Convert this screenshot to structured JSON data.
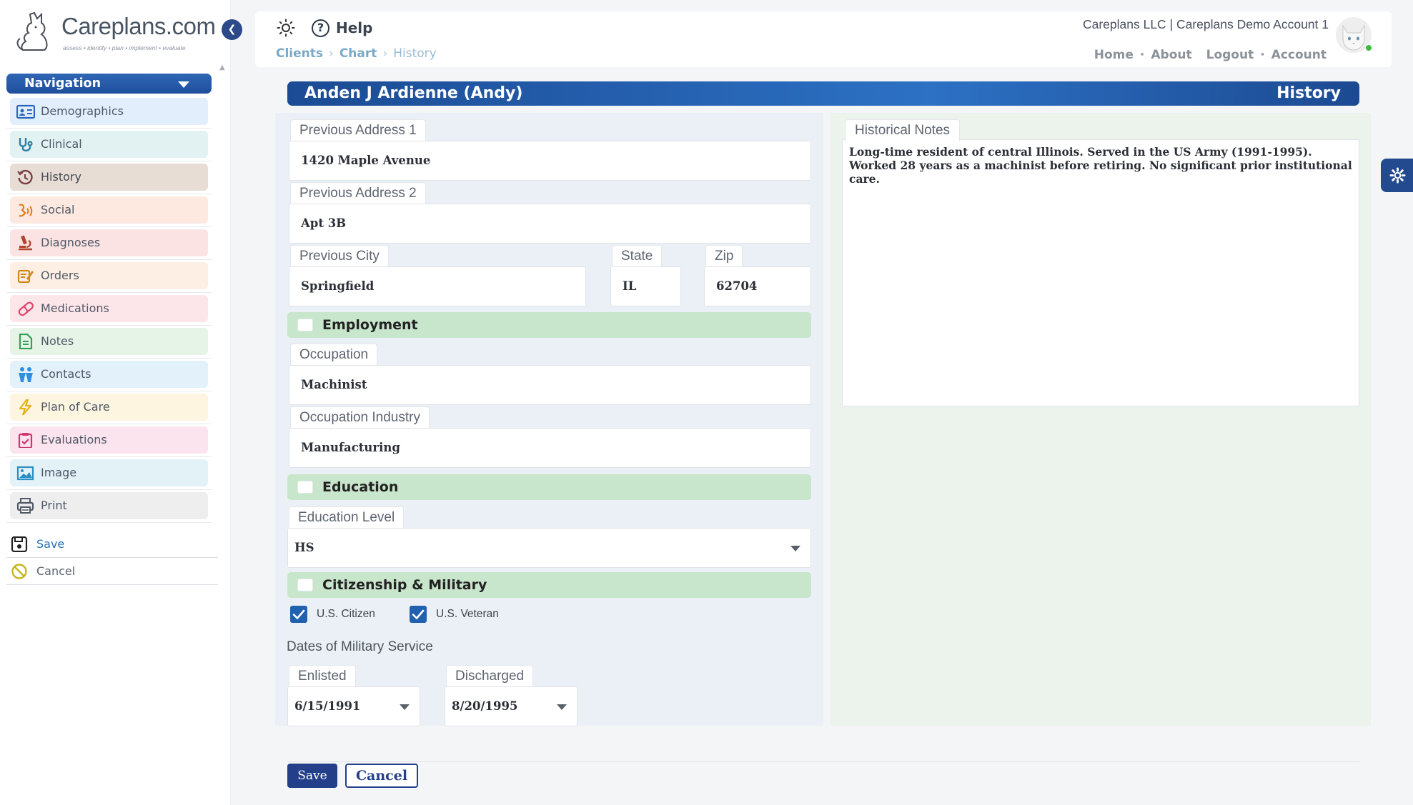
{
  "brand": {
    "name": "Careplans.com",
    "tagline": "assess • identify • plan • implement • evaluate"
  },
  "nav": {
    "header": "Navigation",
    "items": [
      {
        "label": "Demographics",
        "icon": "id-card-icon",
        "bg": "#e3eefc",
        "color": "#2a66c0"
      },
      {
        "label": "Clinical",
        "icon": "stethoscope-icon",
        "bg": "#e2f1f1",
        "color": "#2a7fa6"
      },
      {
        "label": "History",
        "icon": "history-icon",
        "bg": "#e7ddd4",
        "color": "#7a3f4a"
      },
      {
        "label": "Social",
        "icon": "social-icon",
        "bg": "#fde9df",
        "color": "#e07a1f"
      },
      {
        "label": "Diagnoses",
        "icon": "microscope-icon",
        "bg": "#fbe3e3",
        "color": "#b0462d"
      },
      {
        "label": "Orders",
        "icon": "orders-icon",
        "bg": "#fdefe3",
        "color": "#d28a17"
      },
      {
        "label": "Medications",
        "icon": "pill-icon",
        "bg": "#fde6ea",
        "color": "#e0456b"
      },
      {
        "label": "Notes",
        "icon": "note-icon",
        "bg": "#e6f4e8",
        "color": "#34a053"
      },
      {
        "label": "Contacts",
        "icon": "people-icon",
        "bg": "#e3f1fb",
        "color": "#2d8fe0"
      },
      {
        "label": "Plan of Care",
        "icon": "bolt-icon",
        "bg": "#fdf5df",
        "color": "#e6b318"
      },
      {
        "label": "Evaluations",
        "icon": "clipboard-icon",
        "bg": "#fbe4ee",
        "color": "#d1356f"
      },
      {
        "label": "Image",
        "icon": "image-icon",
        "bg": "#e2f2f7",
        "color": "#2b8fc4"
      },
      {
        "label": "Print",
        "icon": "printer-icon",
        "bg": "#eeeeef",
        "color": "#4f5a66"
      }
    ],
    "save_label": "Save",
    "cancel_label": "Cancel"
  },
  "topbar": {
    "help_label": "Help",
    "breadcrumb": [
      "Clients",
      "Chart",
      "History"
    ],
    "account_name": "Careplans LLC | Careplans Demo Account 1",
    "links": [
      "Home",
      "About",
      "Logout",
      "Account"
    ]
  },
  "page": {
    "client_name": "Anden J Ardienne (Andy)",
    "section_title": "History"
  },
  "form": {
    "prev_address1": {
      "label": "Previous Address 1",
      "value": "1420 Maple Avenue"
    },
    "prev_address2": {
      "label": "Previous Address 2",
      "value": "Apt 3B"
    },
    "prev_city": {
      "label": "Previous City",
      "value": "Springfield"
    },
    "state": {
      "label": "State",
      "value": "IL"
    },
    "zip": {
      "label": "Zip",
      "value": "62704"
    },
    "employment_header": "Employment",
    "occupation": {
      "label": "Occupation",
      "value": "Machinist"
    },
    "occupation_industry": {
      "label": "Occupation Industry",
      "value": "Manufacturing"
    },
    "education_header": "Education",
    "education_level": {
      "label": "Education Level",
      "value": "HS"
    },
    "citizenship_header": "Citizenship & Military",
    "us_citizen": {
      "label": "U.S. Citizen",
      "checked": true
    },
    "us_veteran": {
      "label": "U.S. Veteran",
      "checked": true
    },
    "military_caption": "Dates of Military Service",
    "enlisted": {
      "label": "Enlisted",
      "value": "6/15/1991"
    },
    "discharged": {
      "label": "Discharged",
      "value": "8/20/1995"
    },
    "historical_notes": {
      "label": "Historical Notes",
      "value": "Long-time resident of central Illinois. Served in the US Army (1991-1995). Worked 28 years as a machinist before retiring. No significant prior institutional care."
    }
  },
  "footer": {
    "save_label": "Save",
    "cancel_label": "Cancel"
  },
  "colors": {
    "brand_blue": "#1f4f9c",
    "section_green": "#c8e6cc",
    "left_panel": "#ebf0f6",
    "right_panel": "#ebf3ec",
    "link_blue": "#7aa9c8"
  }
}
